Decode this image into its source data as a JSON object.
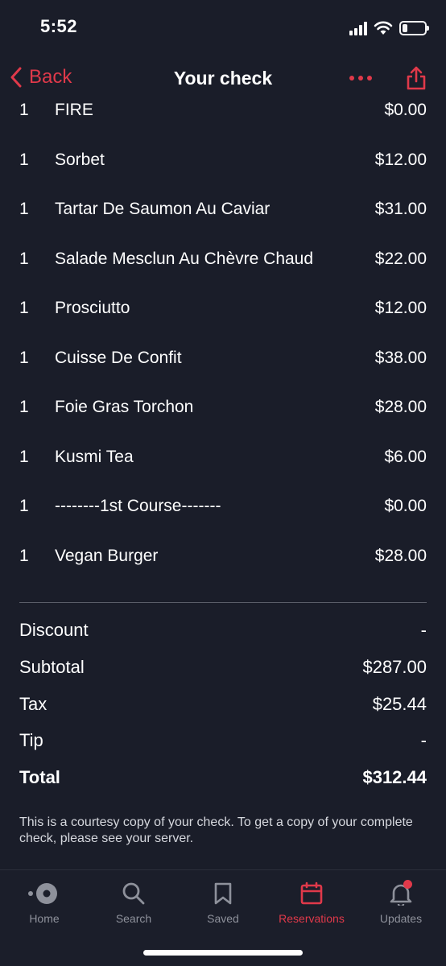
{
  "status_bar": {
    "time": "5:52"
  },
  "nav": {
    "back_label": "Back",
    "title": "Your check"
  },
  "items": [
    {
      "qty": "1",
      "name": "FIRE",
      "price": "$0.00"
    },
    {
      "qty": "1",
      "name": "Sorbet",
      "price": "$12.00"
    },
    {
      "qty": "1",
      "name": "Tartar De Saumon Au Caviar",
      "price": "$31.00"
    },
    {
      "qty": "1",
      "name": "Salade Mesclun Au Chèvre Chaud",
      "price": "$22.00"
    },
    {
      "qty": "1",
      "name": "Prosciutto",
      "price": "$12.00"
    },
    {
      "qty": "1",
      "name": "Cuisse De Confit",
      "price": "$38.00"
    },
    {
      "qty": "1",
      "name": "Foie Gras Torchon",
      "price": "$28.00"
    },
    {
      "qty": "1",
      "name": "Kusmi Tea",
      "price": "$6.00"
    },
    {
      "qty": "1",
      "name": "--------1st Course-------",
      "price": "$0.00"
    },
    {
      "qty": "1",
      "name": "Vegan Burger",
      "price": "$28.00"
    }
  ],
  "totals": {
    "discount": {
      "label": "Discount",
      "value": "-"
    },
    "subtotal": {
      "label": "Subtotal",
      "value": "$287.00"
    },
    "tax": {
      "label": "Tax",
      "value": "$25.44"
    },
    "tip": {
      "label": "Tip",
      "value": "-"
    },
    "total": {
      "label": "Total",
      "value": "$312.44"
    }
  },
  "note": "This is a courtesy copy of your check. To get a copy of your complete check, please see your server.",
  "tabbar": {
    "tabs": [
      {
        "label": "Home",
        "icon": "home-icon"
      },
      {
        "label": "Search",
        "icon": "search-icon"
      },
      {
        "label": "Saved",
        "icon": "bookmark-icon"
      },
      {
        "label": "Reservations",
        "icon": "calendar-icon",
        "active": true
      },
      {
        "label": "Updates",
        "icon": "bell-icon",
        "badge": true
      }
    ]
  },
  "colors": {
    "background": "#1a1d29",
    "accent": "#e0394a",
    "inactive": "#8e919b",
    "text": "#ffffff"
  }
}
